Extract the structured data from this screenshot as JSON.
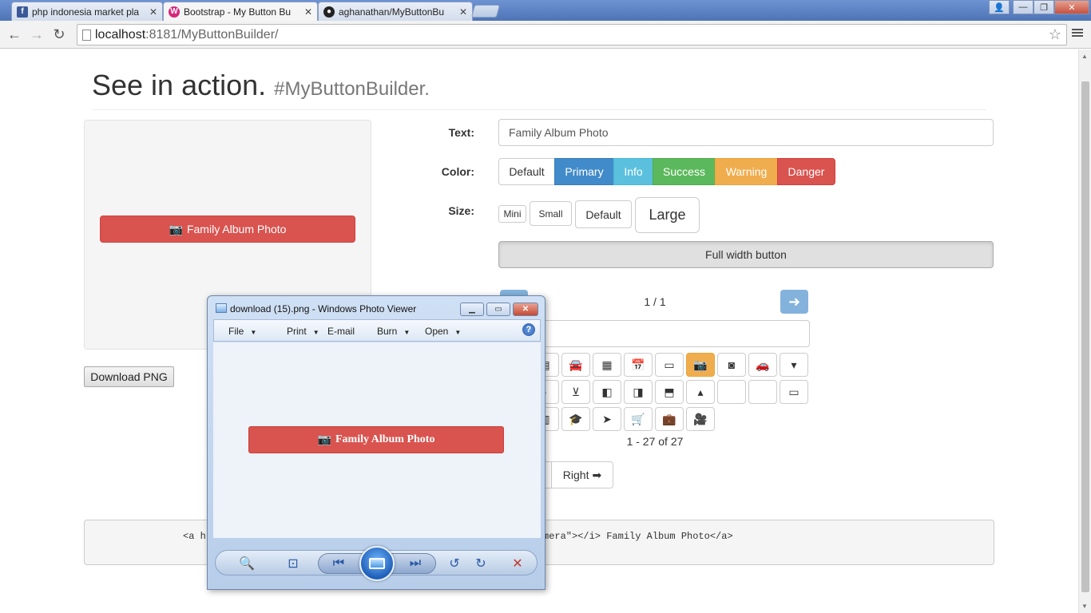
{
  "browser": {
    "tabs": [
      {
        "label": "php indonesia market pla",
        "close": "✕"
      },
      {
        "label": "Bootstrap - My Button Bu",
        "close": "✕"
      },
      {
        "label": "aghanathan/MyButtonBu",
        "close": "✕"
      }
    ],
    "url_host": "localhost",
    "url_rest": ":8181/MyButtonBuilder/"
  },
  "page": {
    "title": "See in action.",
    "subtitle": "#MyButtonBuilder.",
    "preview_button_label": "Family Album Photo",
    "download_label": "Download PNG",
    "text_label": "Text:",
    "text_value": "Family Album Photo",
    "color_label": "Color:",
    "colors": [
      "Default",
      "Primary",
      "Info",
      "Success",
      "Warning",
      "Danger"
    ],
    "size_label": "Size:",
    "sizes": [
      "Mini",
      "Small",
      "Default",
      "Large"
    ],
    "full_width_label": "Full width button",
    "pager_text": "1 / 1",
    "icon_count": "1 - 27 of 27",
    "right_label": "Right",
    "code_left": "<a h",
    "code_right": "mera\"></i> Family Album Photo</a>"
  },
  "photo_viewer": {
    "title": "download (15).png - Windows Photo Viewer",
    "menu": [
      "File",
      "Print",
      "E-mail",
      "Burn",
      "Open"
    ],
    "help": "?",
    "image_button_label": "Family Album Photo"
  },
  "colors": {
    "primary": "#428bca",
    "info": "#5bc0de",
    "success": "#5cb85c",
    "warning": "#f0ad4e",
    "danger": "#d9534f"
  }
}
